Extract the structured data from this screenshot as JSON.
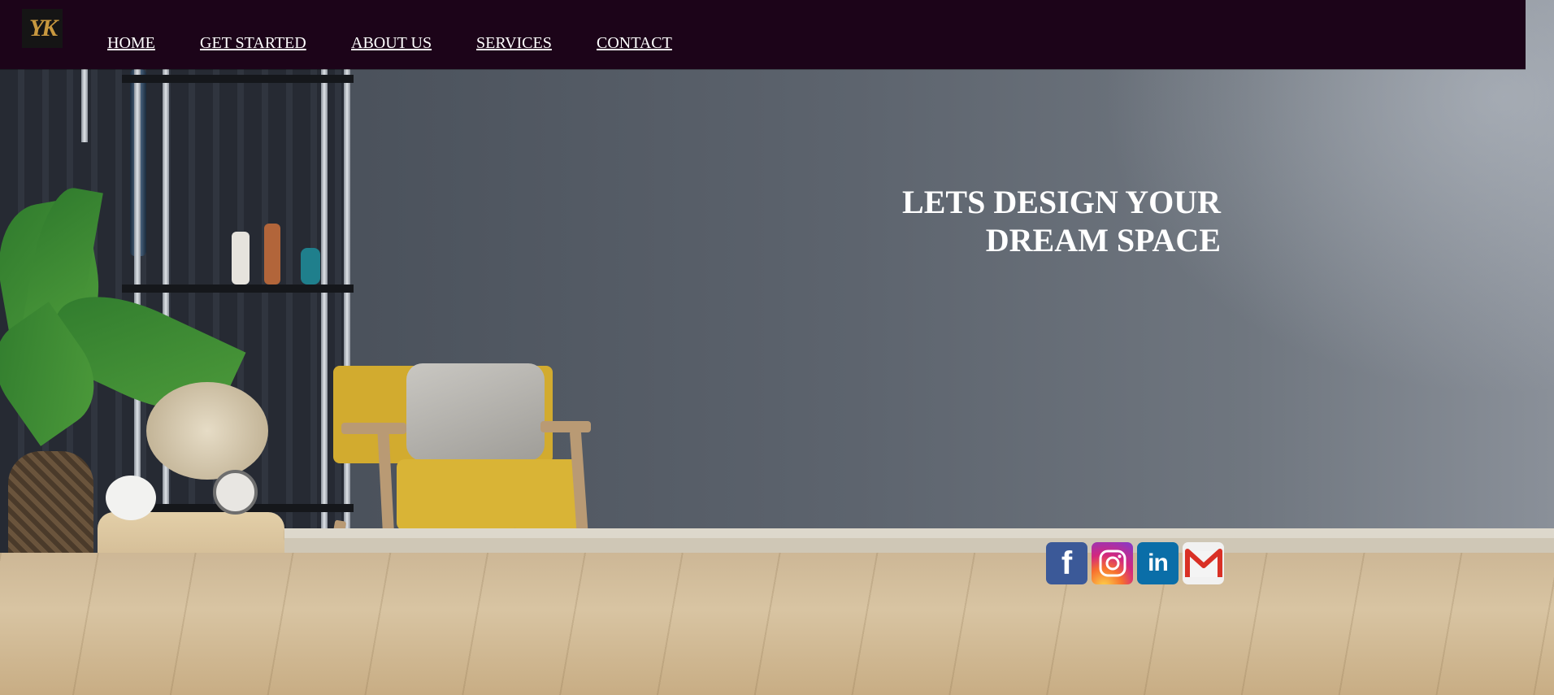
{
  "brand": {
    "logo_text": "YK",
    "logo_color": "#c8983f"
  },
  "nav": {
    "background": "#1c0419",
    "items": [
      {
        "label": "HOME"
      },
      {
        "label": "GET STARTED"
      },
      {
        "label": "ABOUT US"
      },
      {
        "label": "SERVICES"
      },
      {
        "label": "CONTACT"
      }
    ]
  },
  "hero": {
    "headline_line1": "LETS DESIGN YOUR",
    "headline_line2": "DREAM SPACE"
  },
  "social": {
    "facebook": {
      "icon": "facebook-icon",
      "glyph": "f",
      "color": "#3b5998"
    },
    "instagram": {
      "icon": "instagram-icon",
      "color": "#d3287e"
    },
    "linkedin": {
      "icon": "linkedin-icon",
      "glyph": "in",
      "color": "#0a6ea8"
    },
    "gmail": {
      "icon": "gmail-icon",
      "color": "#d93025"
    }
  }
}
